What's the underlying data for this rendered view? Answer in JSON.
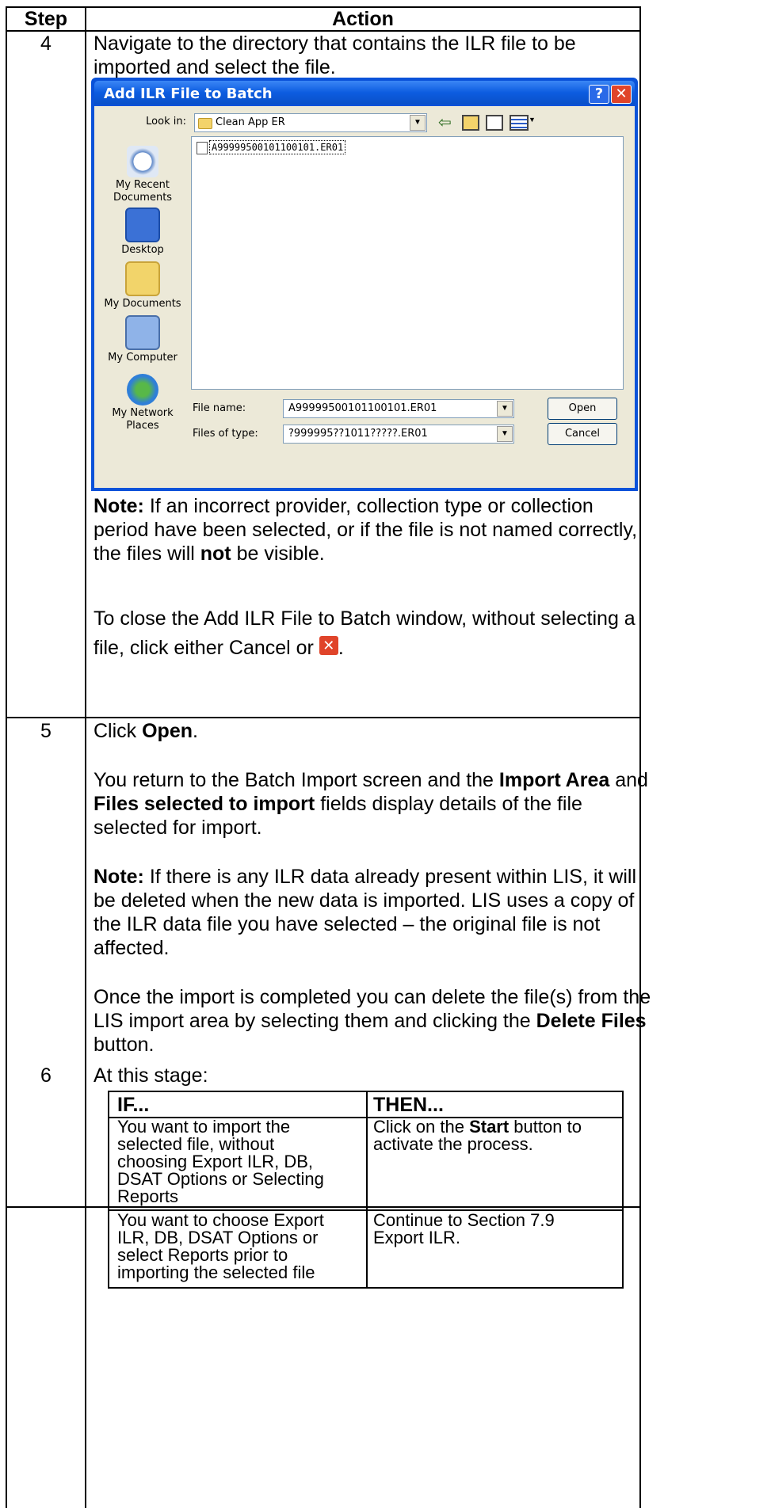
{
  "table": {
    "header": {
      "step": "Step",
      "action": "Action"
    },
    "rows": [
      {
        "step": "4",
        "intro_line1": "Navigate to the directory that contains the ILR file to be",
        "intro_line2": "imported and select the file.",
        "note_label": "Note:",
        "note_line1_rest": " If an incorrect provider, collection type or collection",
        "note_line2": "period have been selected, or if the file is not named correctly,",
        "note_line3_pre": "the files will ",
        "note_line3_bold": "not",
        "note_line3_post": " be visible.",
        "close_line1": "To close the Add ILR File to Batch window, without selecting a",
        "close_line2_pre": "file, click either Cancel or ",
        "close_line2_post": "."
      },
      {
        "step": "5",
        "click_pre": "Click ",
        "click_bold": "Open",
        "click_post": ".",
        "p1_l1_pre": "You return to the Batch Import screen and the ",
        "p1_l1_bold": "Import Area",
        "p1_l1_post": " and",
        "p1_l2_bold": "Files selected to import",
        "p1_l2_post": " fields display details of the file",
        "p1_l3": "selected for import.",
        "note_label": "Note:",
        "p2_l1_rest": " If there is any ILR data already present within LIS, it will",
        "p2_l2": "be deleted when the new data is imported. LIS uses a copy of",
        "p2_l3": "the ILR data file you have selected – the original file is not",
        "p2_l4": "affected.",
        "p3_l1": "Once the import is completed you can delete the file(s) from the",
        "p3_l2_pre": "LIS import area by selecting them and clicking the ",
        "p3_l2_bold": "Delete Files",
        "p3_l3": "button."
      },
      {
        "step": "6",
        "intro": "At this stage:",
        "inner": {
          "if_header": "IF...",
          "then_header": "THEN...",
          "r1_if": [
            "You want to import the",
            "selected file, without",
            "choosing Export ILR, DB,",
            "DSAT Options or Selecting",
            "Reports"
          ],
          "r1_then_l1_pre": "Click on the ",
          "r1_then_l1_bold": "Start",
          "r1_then_l1_post": " button to",
          "r1_then_l2": "activate the process.",
          "r2_if": [
            "You want to choose Export",
            "ILR, DB, DSAT Options or",
            "select Reports prior to",
            "importing the selected file"
          ],
          "r2_then": [
            "Continue to Section 7.9",
            "Export ILR."
          ]
        }
      }
    ]
  },
  "dialog": {
    "title": "Add ILR File to Batch",
    "help_btn": "?",
    "close_btn": "✕",
    "look_in_label": "Look in:",
    "look_in_value": "Clean App ER",
    "places": [
      "My Recent Documents",
      "Desktop",
      "My Documents",
      "My Computer",
      "My Network Places"
    ],
    "file_item": "A99999500101100101.ER01",
    "file_name_label": "File name:",
    "file_name_value": "A99999500101100101.ER01",
    "files_of_type_label": "Files of type:",
    "files_of_type_value": "?999995??1011?????.ER01",
    "open_btn": "Open",
    "cancel_btn": "Cancel",
    "colors": {
      "titlebar": "#0c5ce0",
      "close": "#e0442a",
      "body": "#ece9d8"
    }
  }
}
